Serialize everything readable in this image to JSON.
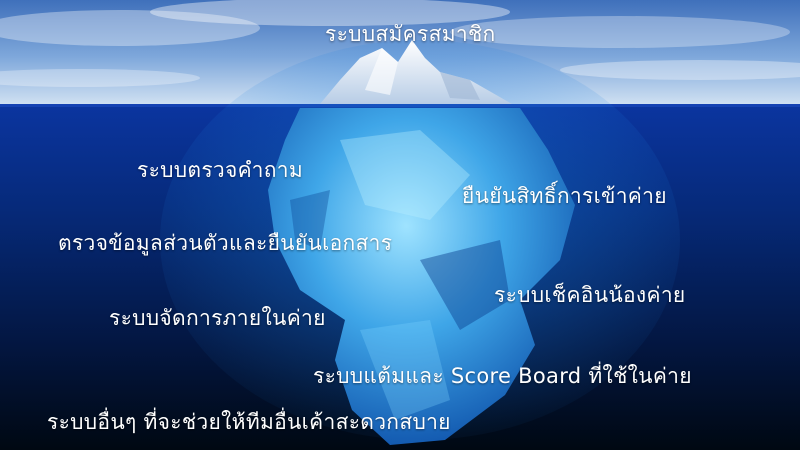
{
  "labels": {
    "top": "ระบบสมัครสมาชิก",
    "questions": "ระบบตรวจคำถาม",
    "confirm_camp": "ยืนยันสิทธิ์การเข้าค่าย",
    "documents": "ตรวจข้อมูลส่วนตัวและยืนยันเอกสาร",
    "checkin": "ระบบเช็คอินน้องค่าย",
    "internal": "ระบบจัดการภายในค่าย",
    "score": "ระบบแต้มและ Score Board ที่ใช้ในค่าย",
    "other": "ระบบอื่นๆ ที่จะช่วยให้ทีมอื่นเค้าสะดวกสบาย"
  },
  "colors": {
    "sky_top": "#4a7cc4",
    "sky_horizon": "#cfe0f2",
    "ocean_surface": "#0a2e8c",
    "ocean_deep": "#000a1e",
    "ice_underwater": "#3fa6e8",
    "ice_above": "#f2f6fb"
  }
}
